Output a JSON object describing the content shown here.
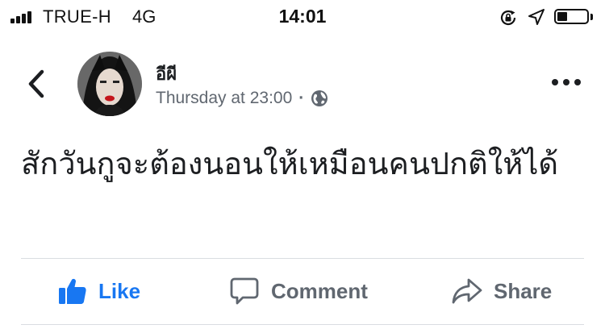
{
  "status_bar": {
    "carrier": "TRUE-H",
    "network": "4G",
    "time": "14:01",
    "icons": [
      "signal-icon",
      "orientation-lock-icon",
      "location-icon",
      "battery-icon"
    ]
  },
  "post": {
    "author": "อีผี",
    "timestamp": "Thursday at 23:00",
    "separator": "·",
    "privacy_icon": "globe-icon",
    "text": "สักวันกูจะต้องนอนให้เหมือนคนปกติให้ได้"
  },
  "actions": {
    "like_label": "Like",
    "comment_label": "Comment",
    "share_label": "Share"
  },
  "colors": {
    "like_blue": "#1877f2",
    "secondary_gray": "#606770",
    "text": "#1c1e21",
    "divider": "#dadde1"
  }
}
